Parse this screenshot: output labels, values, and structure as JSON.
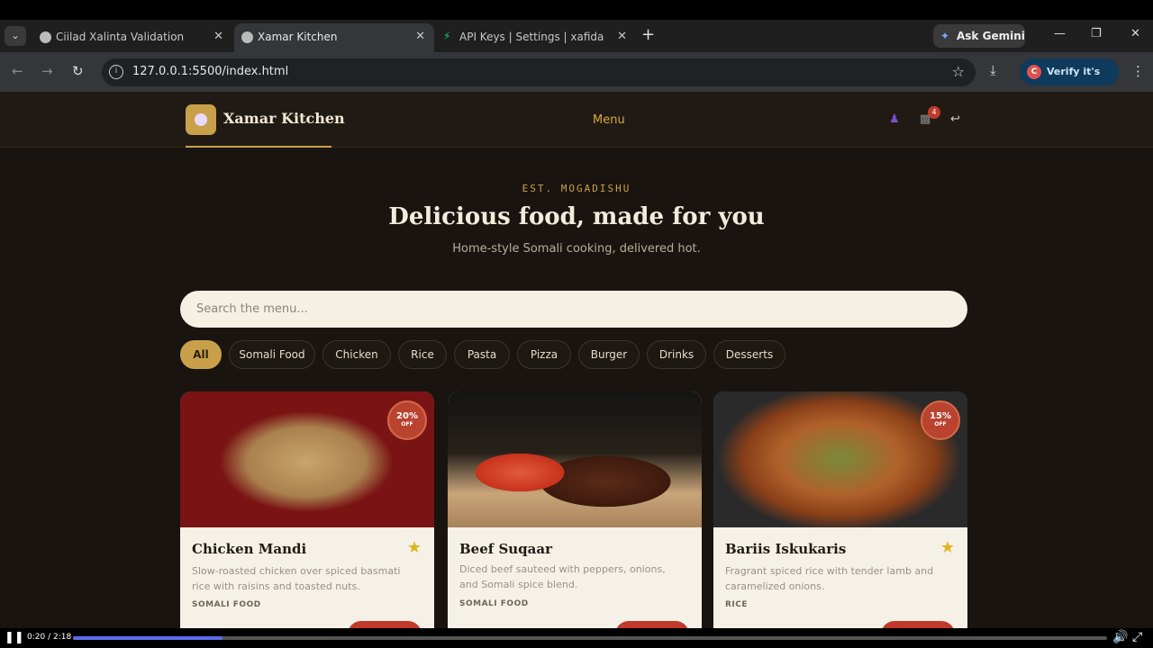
{
  "browser": {
    "tabs": [
      {
        "title": "Ciilad Xalinta Validation",
        "active": false
      },
      {
        "title": "Xamar Kitchen",
        "active": true
      },
      {
        "title": "API Keys | Settings | xafidabdica",
        "active": false
      }
    ],
    "new_tab_icon": "+",
    "ask_gemini_label": "Ask Gemini",
    "url": "127.0.0.1:5500/index.html",
    "verify_label": "Verify it's you",
    "verify_avatar_letter": "C"
  },
  "site": {
    "brand_name": "Xamar Kitchen",
    "nav_menu_label": "Menu",
    "cart_count": "4",
    "accent_color": "#c9a04a",
    "background_color": "#1a1410"
  },
  "hero": {
    "eyebrow": "EST. MOGADISHU",
    "title": "Delicious food, made for you",
    "subtitle": "Home-style Somali cooking, delivered hot."
  },
  "search": {
    "placeholder": "Search the menu..."
  },
  "categories": [
    {
      "label": "All",
      "active": true
    },
    {
      "label": "Somali Food",
      "active": false
    },
    {
      "label": "Chicken",
      "active": false
    },
    {
      "label": "Rice",
      "active": false
    },
    {
      "label": "Pasta",
      "active": false
    },
    {
      "label": "Pizza",
      "active": false
    },
    {
      "label": "Burger",
      "active": false
    },
    {
      "label": "Drinks",
      "active": false
    },
    {
      "label": "Desserts",
      "active": false
    }
  ],
  "menu_items": [
    {
      "title": "Chicken Mandi",
      "description": "Slow-roasted chicken over spiced basmati rice with raisins and toasted nuts.",
      "category": "SOMALI FOOD",
      "discount": "20%",
      "discount_suffix": "OFF",
      "favorite": true
    },
    {
      "title": "Beef Suqaar",
      "description": "Diced beef sauteed with peppers, onions, and Somali spice blend.",
      "category": "SOMALI FOOD",
      "discount": "",
      "discount_suffix": "",
      "favorite": false
    },
    {
      "title": "Bariis Iskukaris",
      "description": "Fragrant spiced rice with tender lamb and caramelized onions.",
      "category": "RICE",
      "discount": "15%",
      "discount_suffix": "OFF",
      "favorite": true
    }
  ],
  "player": {
    "time": "0:20 / 2:18",
    "progress": 0.145
  }
}
